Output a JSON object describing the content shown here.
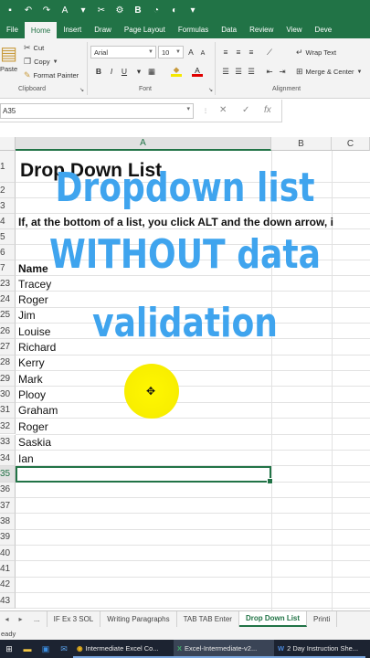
{
  "ribbon_tabs": [
    "File",
    "Home",
    "Insert",
    "Draw",
    "Page Layout",
    "Formulas",
    "Data",
    "Review",
    "View",
    "Deve"
  ],
  "active_tab": "Home",
  "clipboard": {
    "paste": "Paste",
    "cut": "Cut",
    "copy": "Copy",
    "format_painter": "Format Painter",
    "label": "Clipboard"
  },
  "font": {
    "name": "Arial",
    "size": "10",
    "bold": "B",
    "italic": "I",
    "underline": "U",
    "label": "Font"
  },
  "alignment": {
    "wrap": "Wrap Text",
    "merge": "Merge & Center",
    "label": "Alignment"
  },
  "name_box": "A35",
  "formula_icons": {
    "cancel": "✕",
    "enter": "✓",
    "fx": "fx"
  },
  "columns": [
    "A",
    "B",
    "C"
  ],
  "selected_column": "A",
  "rows": [
    {
      "num": "1",
      "text": "Drop Down List",
      "style": "title"
    },
    {
      "num": "2",
      "text": ""
    },
    {
      "num": "3",
      "text": ""
    },
    {
      "num": "4",
      "text": "If, at the bottom of a list, you click ALT and the down arrow, i",
      "style": "bold"
    },
    {
      "num": "5",
      "text": ""
    },
    {
      "num": "6",
      "text": ""
    },
    {
      "num": "7",
      "text": "Name",
      "style": "bold"
    },
    {
      "num": "23",
      "text": "Tracey"
    },
    {
      "num": "24",
      "text": "Roger"
    },
    {
      "num": "25",
      "text": "Jim"
    },
    {
      "num": "26",
      "text": "Louise"
    },
    {
      "num": "27",
      "text": "Richard"
    },
    {
      "num": "28",
      "text": "Kerry"
    },
    {
      "num": "29",
      "text": "Mark"
    },
    {
      "num": "30",
      "text": "Plooy"
    },
    {
      "num": "31",
      "text": "Graham"
    },
    {
      "num": "32",
      "text": "Roger"
    },
    {
      "num": "33",
      "text": "Saskia"
    },
    {
      "num": "34",
      "text": "Ian"
    },
    {
      "num": "35",
      "text": "",
      "selected": true
    },
    {
      "num": "36",
      "text": ""
    },
    {
      "num": "37",
      "text": ""
    },
    {
      "num": "38",
      "text": ""
    },
    {
      "num": "39",
      "text": ""
    },
    {
      "num": "40",
      "text": ""
    },
    {
      "num": "41",
      "text": ""
    },
    {
      "num": "42",
      "text": ""
    },
    {
      "num": "43",
      "text": ""
    }
  ],
  "overlay_lines": [
    "Dropdown list",
    "WITHOUT data",
    "validation"
  ],
  "sheet_tabs": [
    "...",
    "IF Ex 3  SOL",
    "Writing Paragraphs",
    "TAB TAB Enter",
    "Drop Down List",
    "Printi"
  ],
  "active_sheet": "Drop Down List",
  "status": "eady",
  "taskbar_apps": [
    "Intermediate Excel Co...",
    "Excel-Intermediate-v2...",
    "2 Day Instruction She..."
  ],
  "colors": {
    "excel_green": "#217346",
    "overlay_blue": "#3fa4ee",
    "highlight_yellow": "#f8ee00",
    "taskbar": "#1c2331"
  },
  "icons": [
    "undo-icon",
    "redo-icon",
    "font-color-icon",
    "cursor-icon",
    "windows-icon",
    "chrome-icon"
  ]
}
